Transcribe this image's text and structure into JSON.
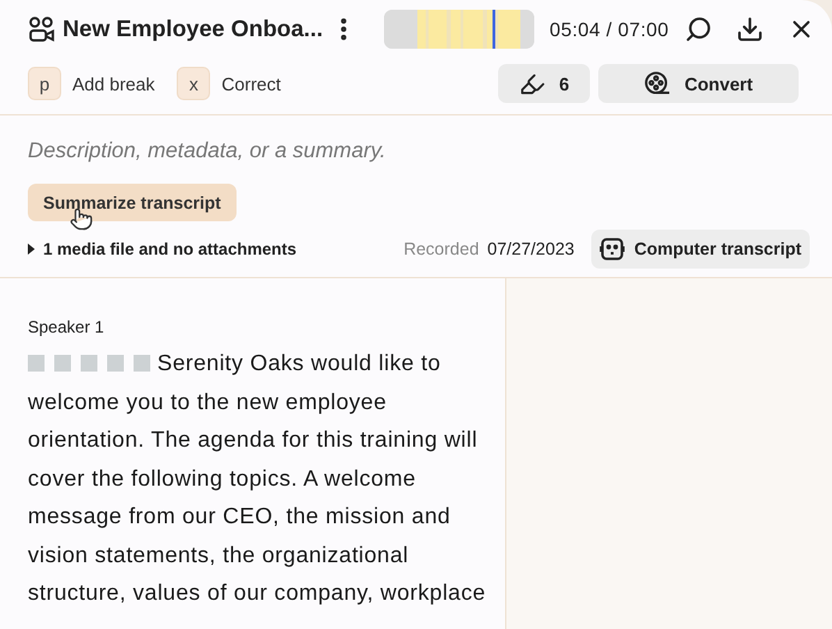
{
  "header": {
    "title": "New Employee Onboa...",
    "timeline": {
      "level": 0.72
    },
    "time": "05:04 / 07:00"
  },
  "toolbar": {
    "shortcuts": [
      {
        "key": "p",
        "label": "Add break"
      },
      {
        "key": "x",
        "label": "Correct"
      }
    ],
    "highlight_count": "6",
    "convert": "Convert"
  },
  "description": {
    "placeholder": "Description, metadata, or a summary."
  },
  "summarize_button": "Summarize transcript",
  "media": {
    "label": "1 media file and no attachments",
    "expanded": false
  },
  "recorded": {
    "label": "Recorded",
    "date": "07/27/2023"
  },
  "transcript_button": "Computer transcript",
  "transcript": {
    "speaker": "Speaker 1",
    "text": "Serenity Oaks would like to welcome you to the new employee orientation. The agenda for this training will cover the following topics. A welcome message from our CEO, the mission and vision statements, the organizational structure, values of our company, workplace"
  }
}
